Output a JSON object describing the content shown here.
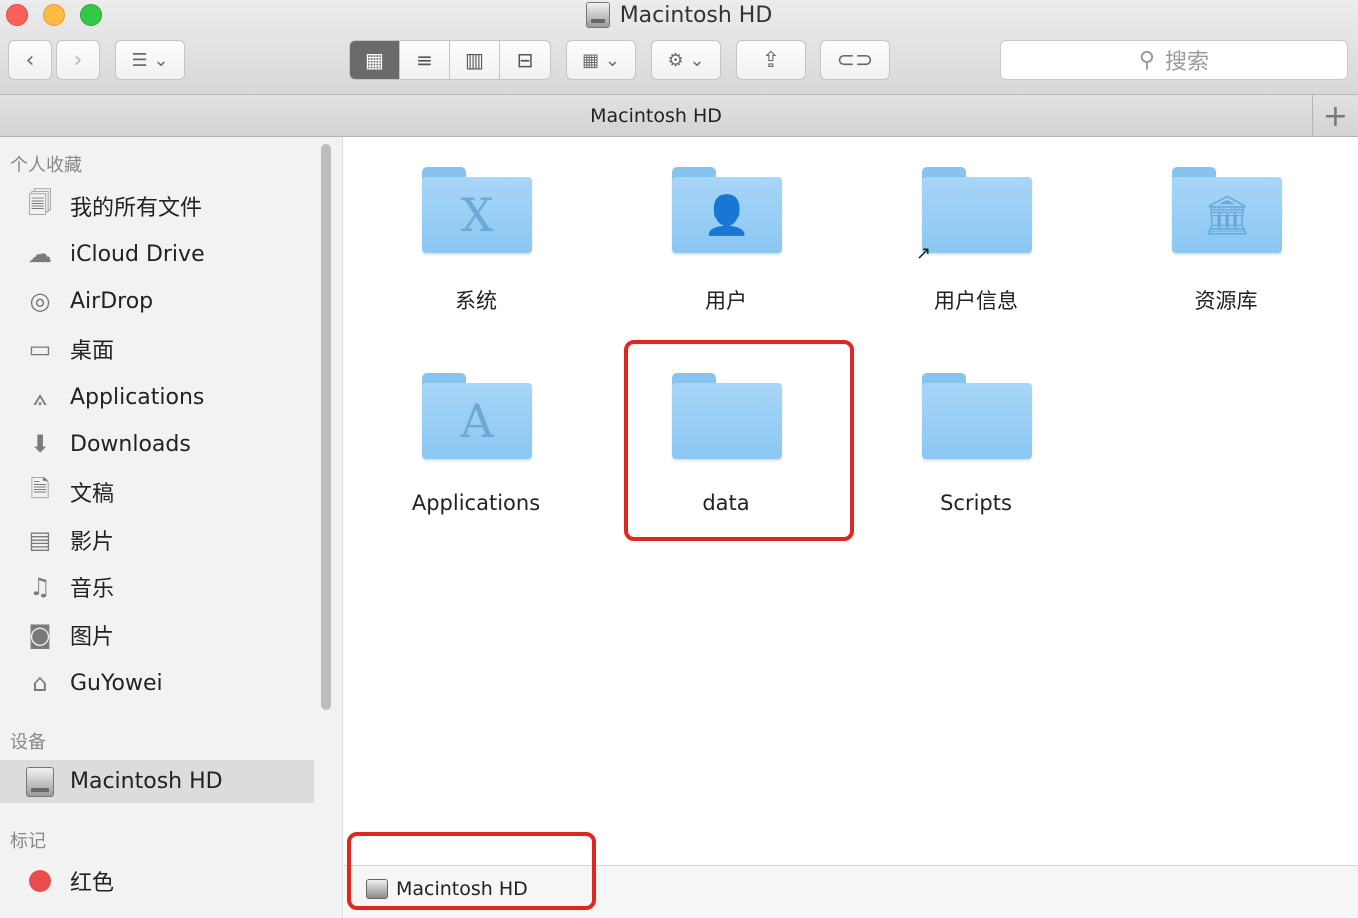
{
  "window": {
    "title": "Macintosh HD"
  },
  "toolbar": {
    "back": "‹",
    "forward": "›",
    "search_placeholder": "搜索"
  },
  "pathbar": {
    "title": "Macintosh HD",
    "add": "+"
  },
  "sidebar": {
    "favorites_header": "个人收藏",
    "items": [
      {
        "label": "我的所有文件",
        "icon": "all-files-icon"
      },
      {
        "label": "iCloud Drive",
        "icon": "cloud-icon"
      },
      {
        "label": "AirDrop",
        "icon": "airdrop-icon"
      },
      {
        "label": "桌面",
        "icon": "desktop-icon"
      },
      {
        "label": "Applications",
        "icon": "applications-icon"
      },
      {
        "label": "Downloads",
        "icon": "downloads-icon"
      },
      {
        "label": "文稿",
        "icon": "documents-icon"
      },
      {
        "label": "影片",
        "icon": "movies-icon"
      },
      {
        "label": "音乐",
        "icon": "music-icon"
      },
      {
        "label": "图片",
        "icon": "pictures-icon"
      },
      {
        "label": "GuYowei",
        "icon": "home-icon"
      }
    ],
    "devices_header": "设备",
    "devices": [
      {
        "label": "Macintosh HD",
        "icon": "disk-icon",
        "selected": true
      }
    ],
    "tags_header": "标记",
    "tags": [
      {
        "label": "红色",
        "color": "#ea4c4c"
      }
    ]
  },
  "files": [
    {
      "name": "系统",
      "glyph": "X"
    },
    {
      "name": "用户",
      "glyph": "👤"
    },
    {
      "name": "用户信息",
      "glyph": "",
      "alias": true
    },
    {
      "name": "资源库",
      "glyph": "🏛"
    },
    {
      "name": "Applications",
      "glyph": "A"
    },
    {
      "name": "data",
      "glyph": ""
    },
    {
      "name": "Scripts",
      "glyph": ""
    }
  ],
  "statusbar": {
    "path": "Macintosh HD"
  },
  "highlight_color": "#e0261f"
}
